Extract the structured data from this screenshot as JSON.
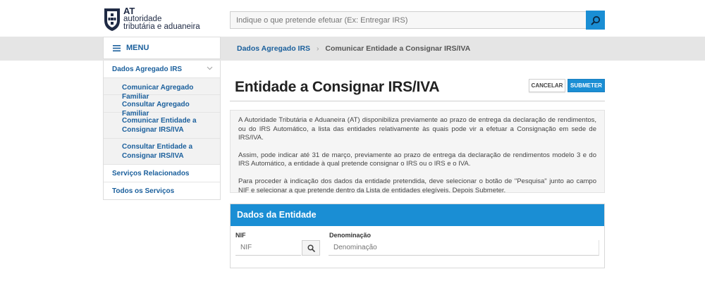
{
  "header": {
    "logo": {
      "short": "AT",
      "line1": "autoridade",
      "line2": "tributária e aduaneira"
    },
    "search": {
      "placeholder": "Indique o que pretende efetuar (Ex: Entregar IRS)"
    }
  },
  "menu": {
    "label": "MENU"
  },
  "breadcrumb": {
    "items": [
      "Dados Agregado IRS",
      "Comunicar Entidade a Consignar IRS/IVA"
    ],
    "separator": "›"
  },
  "sidebar": {
    "section": "Dados Agregado IRS",
    "subitems": [
      "Comunicar Agregado Familiar",
      "Consultar Agregado Familiar",
      "Comunicar Entidade a Consignar IRS/IVA",
      "Consultar Entidade a Consignar IRS/IVA"
    ],
    "items": [
      "Serviços Relacionados",
      "Todos os Serviços"
    ]
  },
  "main": {
    "title": "Entidade a Consignar IRS/IVA",
    "buttons": {
      "cancel": "CANCELAR",
      "submit": "SUBMETER"
    },
    "info": [
      "A Autoridade Tributária e Aduaneira (AT) disponibiliza previamente ao prazo de entrega da declaração de rendimentos, ou do IRS Automático, a lista das entidades relativamente às quais pode vir a efetuar a Consignação em sede de IRS/IVA.",
      "Assim, pode indicar até 31 de março, previamente ao prazo de entrega da declaração de rendimentos modelo 3 e do IRS Automático, a entidade à qual pretende consignar o IRS ou o IRS e o IVA.",
      "Para proceder à indicação dos dados da entidade pretendida, deve selecionar o botão de \"Pesquisa\" junto ao campo NIF e selecionar a que pretende dentro da Lista de entidades elegíveis. Depois Submeter."
    ],
    "panel": {
      "title": "Dados da Entidade",
      "nif_label": "NIF",
      "nif_placeholder": "NIF",
      "den_label": "Denominação",
      "den_placeholder": "Denominação"
    }
  },
  "colors": {
    "accent": "#1a8ed4",
    "link": "#1a5f9c",
    "graybar": "#e5e5e5"
  },
  "icons": {
    "search": "search-icon",
    "menu": "hamburger-icon",
    "chevron": "chevron-down-icon"
  }
}
